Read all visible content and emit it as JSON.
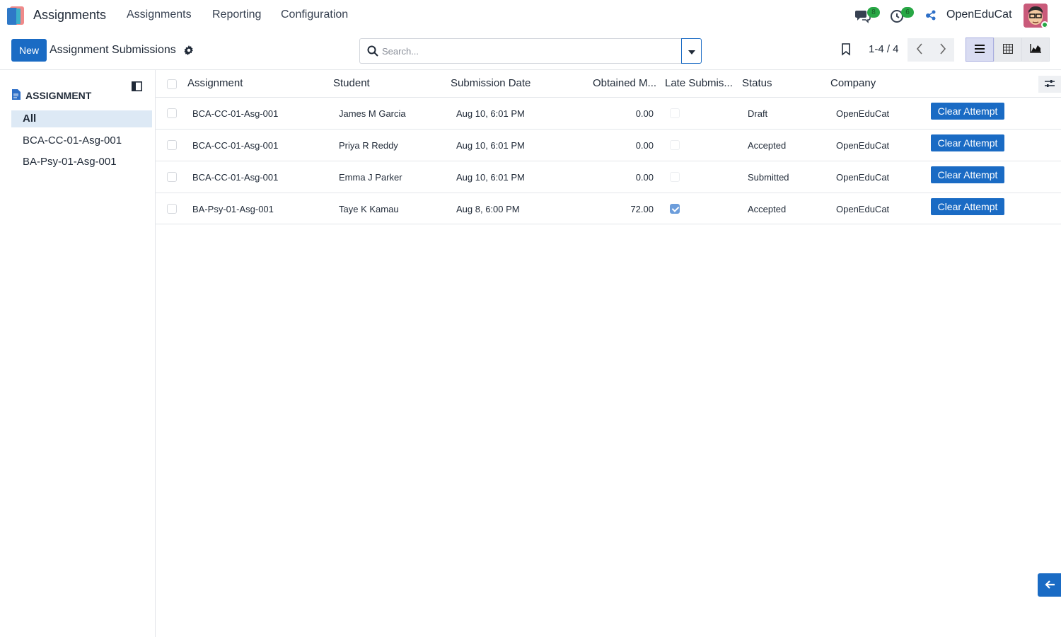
{
  "nav": {
    "app_name": "Assignments",
    "menu": [
      "Assignments",
      "Reporting",
      "Configuration"
    ],
    "messages_count": "8",
    "activities_count": "6",
    "company": "OpenEduCat"
  },
  "control": {
    "new_label": "New",
    "title": "Assignment Submissions",
    "search_placeholder": "Search...",
    "pager": "1-4 / 4"
  },
  "sidebar": {
    "heading": "ASSIGNMENT",
    "items": [
      "All",
      "BCA-CC-01-Asg-001",
      "BA-Psy-01-Asg-001"
    ]
  },
  "table": {
    "columns": [
      "Assignment",
      "Student",
      "Submission Date",
      "Obtained M...",
      "Late Submis...",
      "Status",
      "Company"
    ],
    "rows": [
      {
        "assignment": "BCA-CC-01-Asg-001",
        "student": "James M Garcia",
        "date": "Aug 10, 6:01 PM",
        "marks": "0.00",
        "late": false,
        "status": "Draft",
        "company": "OpenEduCat",
        "action": "Clear Attempt"
      },
      {
        "assignment": "BCA-CC-01-Asg-001",
        "student": "Priya R Reddy",
        "date": "Aug 10, 6:01 PM",
        "marks": "0.00",
        "late": false,
        "status": "Accepted",
        "company": "OpenEduCat",
        "action": "Clear Attempt"
      },
      {
        "assignment": "BCA-CC-01-Asg-001",
        "student": "Emma J Parker",
        "date": "Aug 10, 6:01 PM",
        "marks": "0.00",
        "late": false,
        "status": "Submitted",
        "company": "OpenEduCat",
        "action": "Clear Attempt"
      },
      {
        "assignment": "BA-Psy-01-Asg-001",
        "student": "Taye K Kamau",
        "date": "Aug 8, 6:00 PM",
        "marks": "72.00",
        "late": true,
        "status": "Accepted",
        "company": "OpenEduCat",
        "action": "Clear Attempt"
      }
    ]
  },
  "colors": {
    "primary": "#1a6bc4",
    "badge_green": "#28a745",
    "sidebar_active": "#dde9f5"
  }
}
